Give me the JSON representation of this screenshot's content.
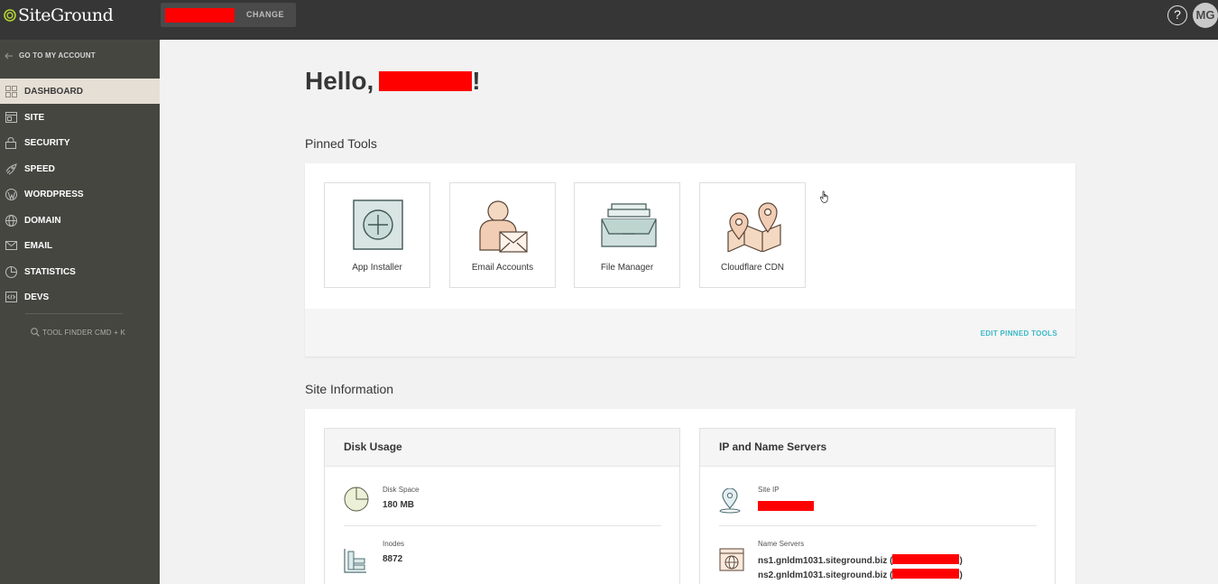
{
  "app": {
    "brand": "SiteGround"
  },
  "topbar": {
    "change_label": "CHANGE",
    "help_label": "?",
    "avatar_initials": "MG"
  },
  "sidebar": {
    "back_label": "GO TO MY ACCOUNT",
    "items": [
      {
        "label": "DASHBOARD",
        "icon": "dashboard-icon",
        "active": true
      },
      {
        "label": "SITE",
        "icon": "site-icon"
      },
      {
        "label": "SECURITY",
        "icon": "lock-icon"
      },
      {
        "label": "SPEED",
        "icon": "rocket-icon"
      },
      {
        "label": "WORDPRESS",
        "icon": "wordpress-icon"
      },
      {
        "label": "DOMAIN",
        "icon": "globe-icon"
      },
      {
        "label": "EMAIL",
        "icon": "envelope-icon"
      },
      {
        "label": "STATISTICS",
        "icon": "pie-chart-icon"
      },
      {
        "label": "DEVS",
        "icon": "code-icon"
      }
    ],
    "tool_finder": "TOOL FINDER CMD + K"
  },
  "main": {
    "greeting": "Hello,",
    "greeting_suffix": "!",
    "pinned_tools": {
      "title": "Pinned Tools",
      "edit_label": "EDIT PINNED TOOLS",
      "tiles": [
        {
          "label": "App Installer",
          "icon": "app-installer-icon"
        },
        {
          "label": "Email Accounts",
          "icon": "email-accounts-icon"
        },
        {
          "label": "File Manager",
          "icon": "file-manager-icon"
        },
        {
          "label": "Cloudflare CDN",
          "icon": "cloudflare-map-icon"
        }
      ]
    },
    "site_information": {
      "title": "Site Information",
      "disk_usage": {
        "title": "Disk Usage",
        "disk_space_label": "Disk Space",
        "disk_space_value": "180 MB",
        "inodes_label": "Inodes",
        "inodes_value": "8872"
      },
      "ip_name_servers": {
        "title": "IP and Name Servers",
        "site_ip_label": "Site IP",
        "name_servers_label": "Name Servers",
        "ns1": "ns1.gnldm1031.siteground.biz",
        "ns2": "ns2.gnldm1031.siteground.biz"
      }
    }
  },
  "colors": {
    "accent": "#3eb8c7",
    "topbar": "#363636",
    "sidebar": "#464641",
    "active_nav": "#e6dfd5",
    "redaction": "#ff0000"
  }
}
